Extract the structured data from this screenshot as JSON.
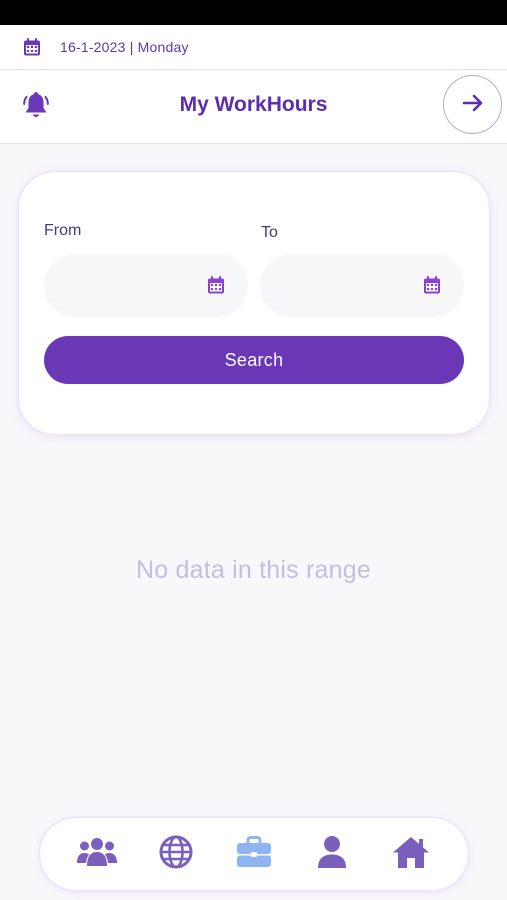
{
  "datebar": {
    "date_text": "16-1-2023 | Monday",
    "icon": "calendar-icon"
  },
  "header": {
    "title": "My WorkHours",
    "left_icon": "bell-icon",
    "right_icon": "arrow-right-icon"
  },
  "filter": {
    "from_label": "From",
    "to_label": "To",
    "from_value": "",
    "to_value": "",
    "field_icon": "calendar-icon",
    "search_label": "Search"
  },
  "empty_state": {
    "message": "No data in this range"
  },
  "bottom_nav": {
    "items": [
      {
        "name": "team",
        "icon": "users-group-icon",
        "active": false
      },
      {
        "name": "globe",
        "icon": "globe-icon",
        "active": false
      },
      {
        "name": "work",
        "icon": "briefcase-icon",
        "active": true
      },
      {
        "name": "profile",
        "icon": "user-icon",
        "active": false
      },
      {
        "name": "home",
        "icon": "home-icon",
        "active": false
      }
    ]
  },
  "colors": {
    "primary": "#6a37b7",
    "title": "#5b2db0",
    "icon": "#7b5fbd",
    "active_icon": "#8fb4f2",
    "empty_text": "#c6bde0",
    "background": "#f8f7fa"
  }
}
